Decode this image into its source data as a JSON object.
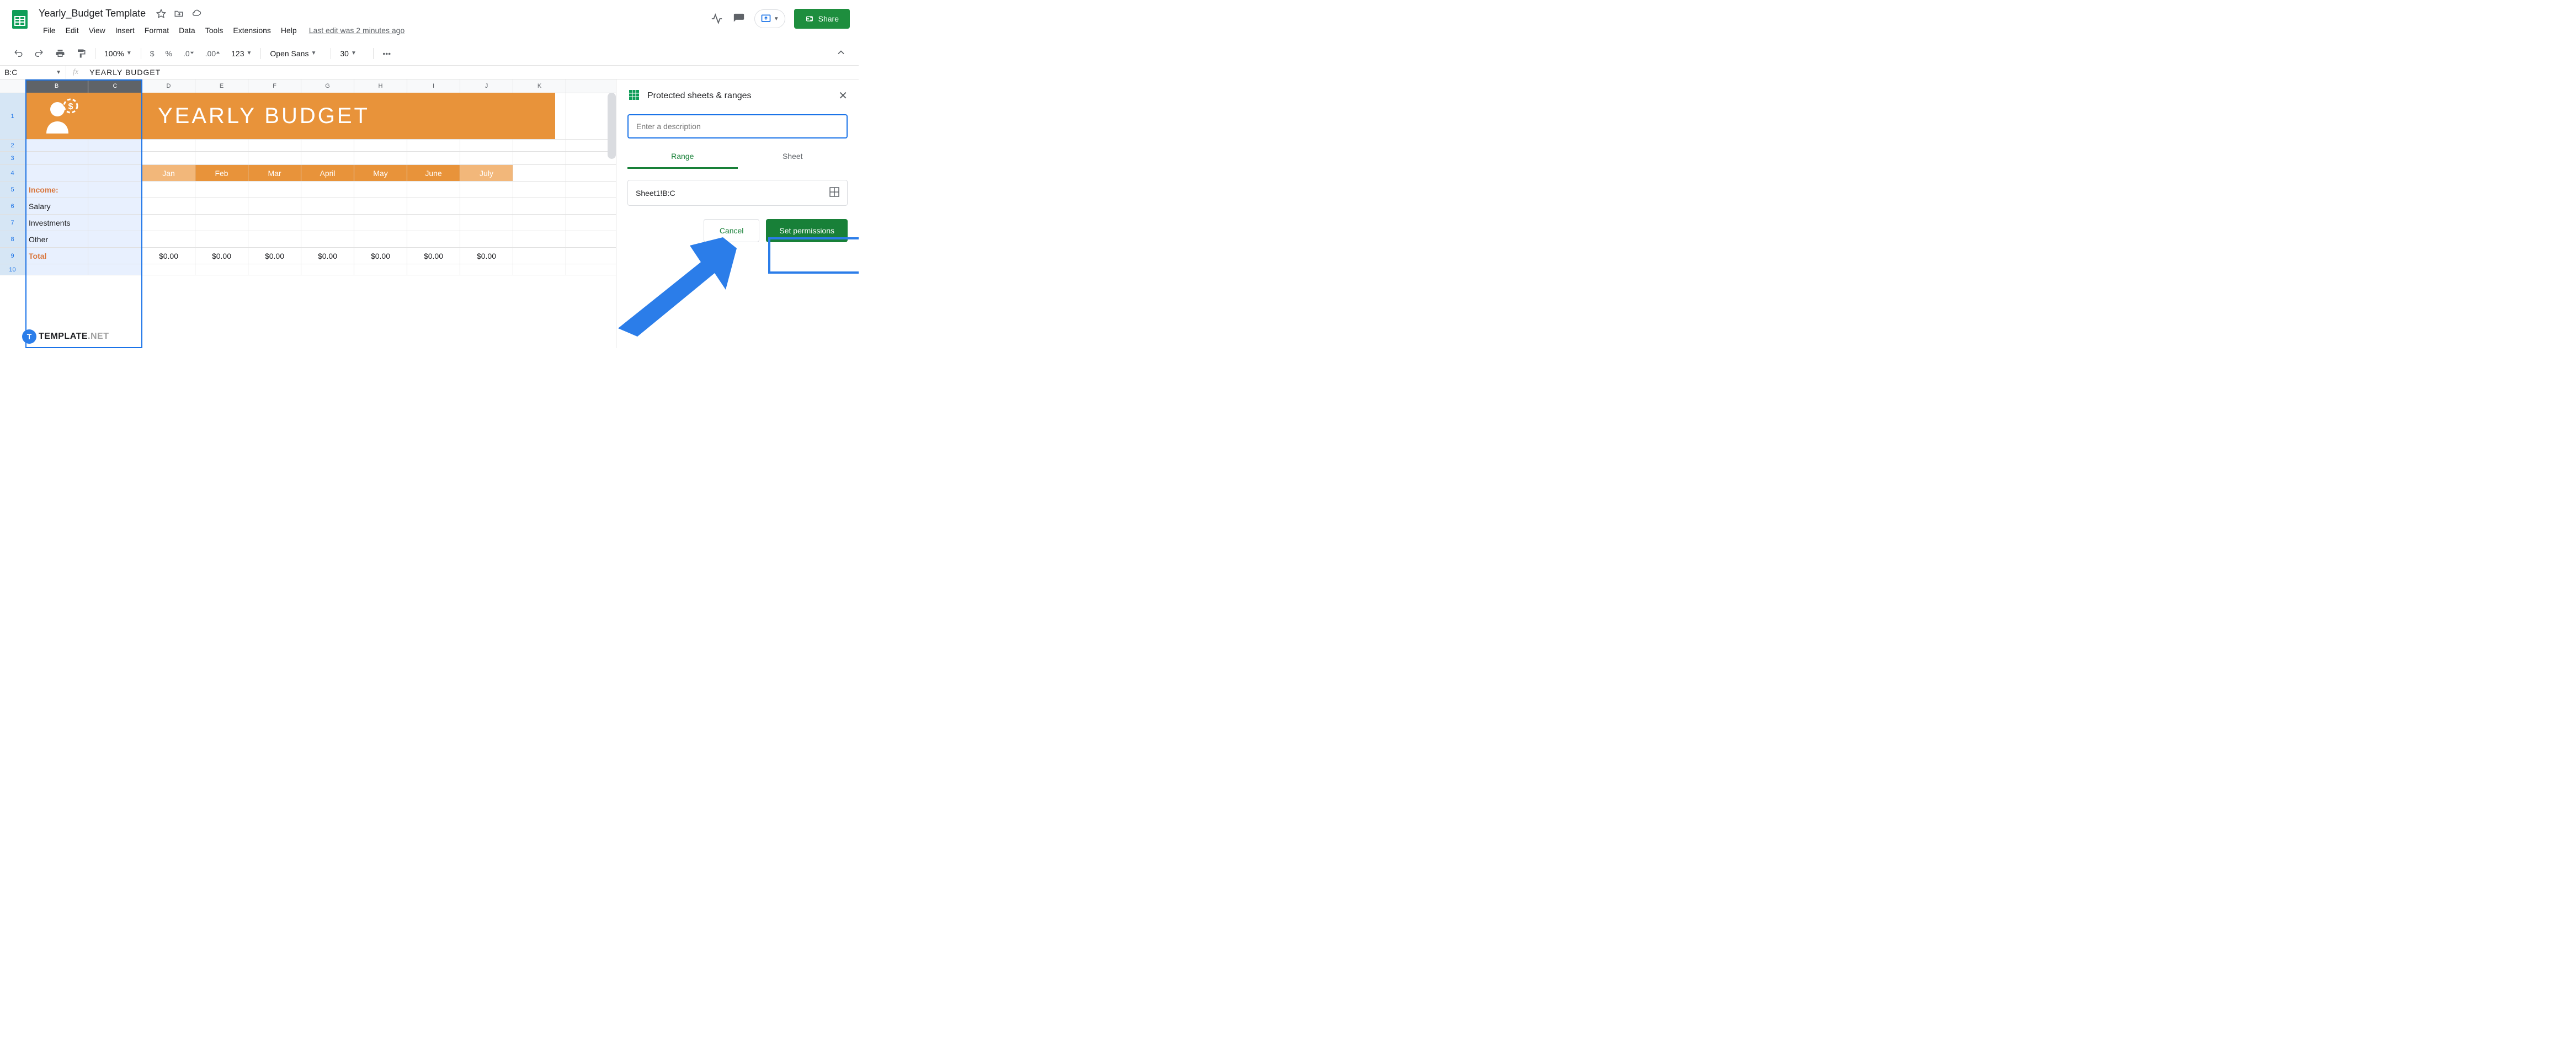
{
  "header": {
    "doc_title": "Yearly_Budget Template",
    "last_edit": "Last edit was 2 minutes ago",
    "share_label": "Share"
  },
  "menu": [
    "File",
    "Edit",
    "View",
    "Insert",
    "Format",
    "Data",
    "Tools",
    "Extensions",
    "Help"
  ],
  "toolbar": {
    "zoom": "100%",
    "currency": "$",
    "percent": "%",
    "dec_dec": ".0",
    "inc_dec": ".00",
    "number_format": "123",
    "font": "Open Sans",
    "font_size": "30",
    "more": "•••"
  },
  "name_box": "B:C",
  "fx_value": "YEARLY  BUDGET",
  "columns": [
    "B",
    "C",
    "D",
    "E",
    "F",
    "G",
    "H",
    "I",
    "J",
    "K"
  ],
  "rows": [
    "1",
    "2",
    "3",
    "4",
    "5",
    "6",
    "7",
    "8",
    "9",
    "10"
  ],
  "banner_text": "YEARLY  BUDGET",
  "months": [
    "Jan",
    "Feb",
    "Mar",
    "April",
    "May",
    "June",
    "July"
  ],
  "income_label": "Income:",
  "income_items": [
    "Salary",
    "Investments",
    "Other"
  ],
  "total_label": "Total",
  "total_values": [
    "$0.00",
    "$0.00",
    "$0.00",
    "$0.00",
    "$0.00",
    "$0.00",
    "$0.00"
  ],
  "side_panel": {
    "title": "Protected sheets & ranges",
    "desc_placeholder": "Enter a description",
    "tab_range": "Range",
    "tab_sheet": "Sheet",
    "range_value": "Sheet1!B:C",
    "cancel": "Cancel",
    "set_permissions": "Set permissions"
  },
  "watermark": {
    "badge": "T",
    "text1": "TEMPLATE",
    "text2": ".NET"
  }
}
